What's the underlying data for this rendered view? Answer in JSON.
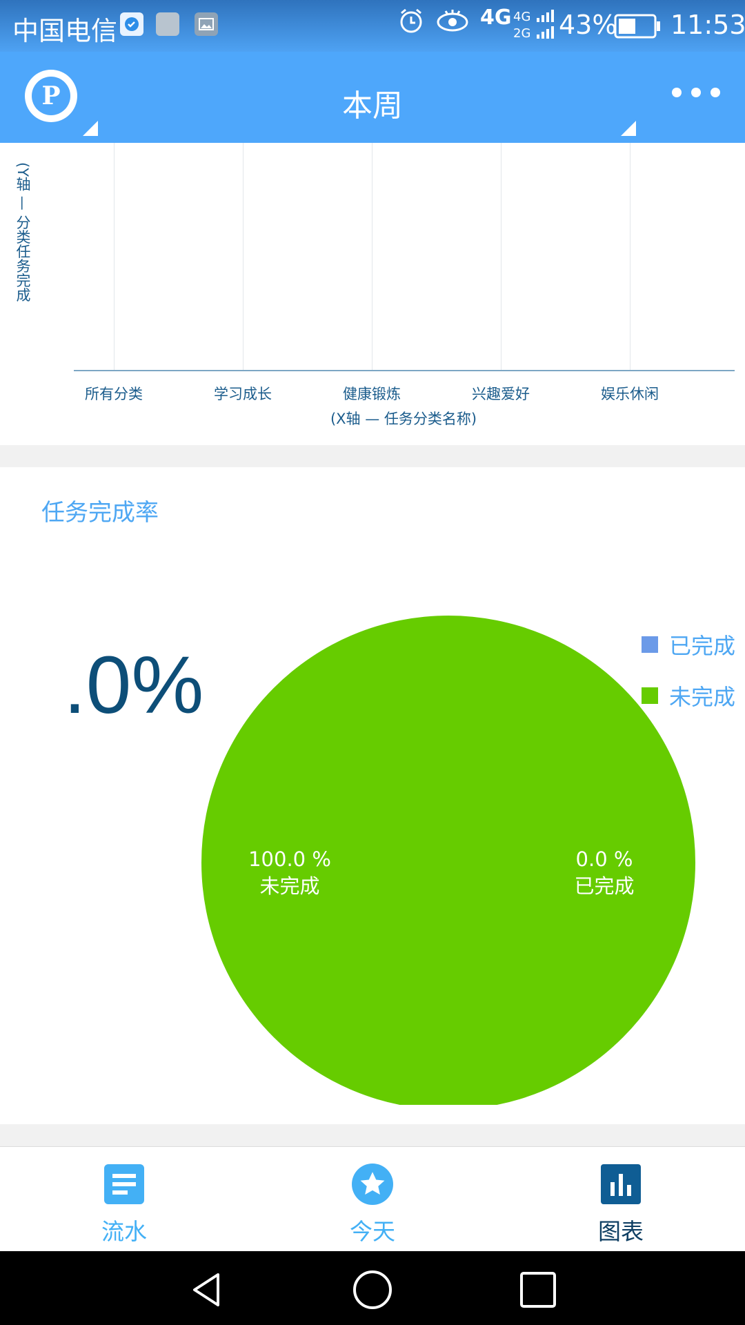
{
  "status_bar": {
    "carrier": "中国电信",
    "network": "4G",
    "network_secondary": "4G 2G",
    "battery": "43%",
    "time": "11:53"
  },
  "app_bar": {
    "title": "本周",
    "logo_letter": "P"
  },
  "category_chart": {
    "y_axis_label": "(Y轴 — 分类任务完成",
    "x_axis_title": "(X轴 — 任务分类名称)",
    "categories": [
      "所有分类",
      "学习成长",
      "健康锻炼",
      "兴趣爱好",
      "娱乐休闲"
    ]
  },
  "completion_card": {
    "title": "任务完成率",
    "big_percent": ".0%",
    "slice_labels": {
      "incomplete_value": "100.0 %",
      "incomplete_name": "未完成",
      "complete_value": "0.0 %",
      "complete_name": "已完成"
    }
  },
  "chart_data": {
    "type": "pie",
    "categories": [
      "已完成",
      "未完成"
    ],
    "values": [
      0.0,
      100.0
    ],
    "colors": [
      "#6b9ae8",
      "#66cc00"
    ],
    "title": "任务完成率",
    "legend_position": "top-right"
  },
  "bottom_nav": {
    "items": [
      {
        "label": "流水",
        "icon": "list-icon",
        "color": "#43b0f5"
      },
      {
        "label": "今天",
        "icon": "star-icon",
        "color": "#43b0f5"
      },
      {
        "label": "图表",
        "icon": "bar-chart-icon",
        "color": "#0f5d94"
      }
    ]
  },
  "system_nav": {
    "icons": [
      "back-icon",
      "home-icon",
      "recents-icon"
    ]
  }
}
